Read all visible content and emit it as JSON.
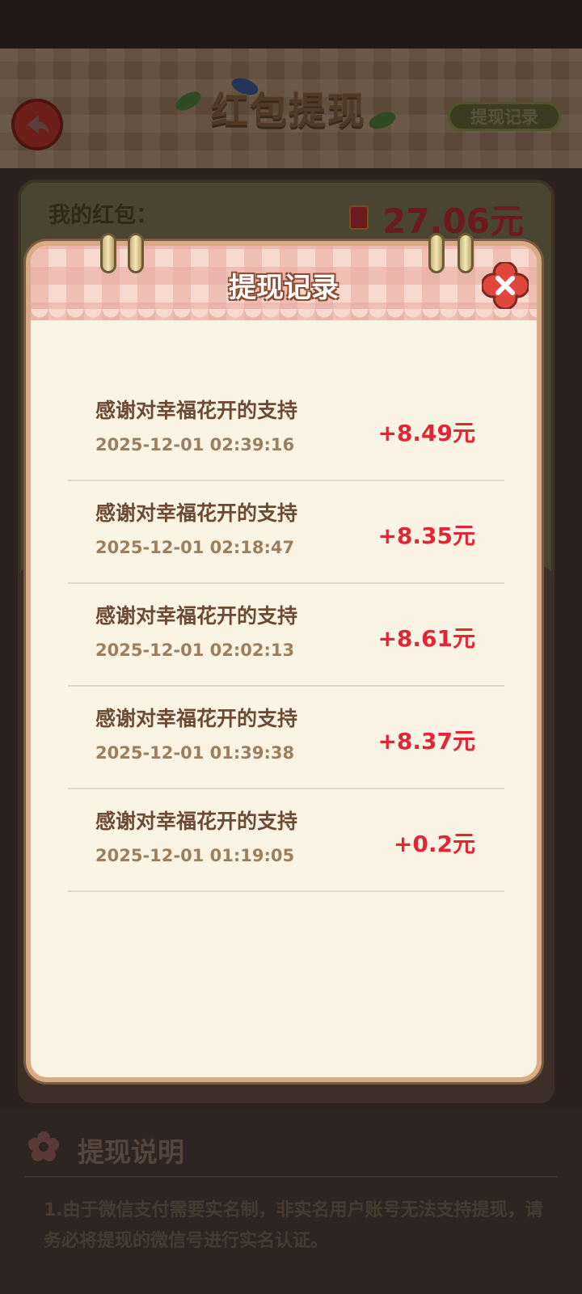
{
  "header": {
    "title": "红包提现",
    "record_link_label": "提现记录"
  },
  "wallet": {
    "label": "我的红包：",
    "amount": "27.06元"
  },
  "modal": {
    "title": "提现记录",
    "records": [
      {
        "title": "感谢对幸福花开的支持",
        "time": "2025-12-01 02:39:16",
        "amount": "+8.49元"
      },
      {
        "title": "感谢对幸福花开的支持",
        "time": "2025-12-01 02:18:47",
        "amount": "+8.35元"
      },
      {
        "title": "感谢对幸福花开的支持",
        "time": "2025-12-01 02:02:13",
        "amount": "+8.61元"
      },
      {
        "title": "感谢对幸福花开的支持",
        "time": "2025-12-01 01:39:38",
        "amount": "+8.37元"
      },
      {
        "title": "感谢对幸福花开的支持",
        "time": "2025-12-01 01:19:05",
        "amount": "+0.2元"
      }
    ]
  },
  "info": {
    "title": "提现说明",
    "text": "1.由于微信支付需要实名制，非实名用户账号无法支持提现，请务必将提现的微信号进行实名认证。"
  },
  "icons": {
    "back": "back-arrow-icon",
    "close": "close-icon",
    "wallet": "red-packet-icon",
    "info": "flower-icon"
  },
  "colors": {
    "amount_red": "#e32636",
    "modal_bg": "#fbf4e4",
    "modal_border": "#d8ab84"
  }
}
